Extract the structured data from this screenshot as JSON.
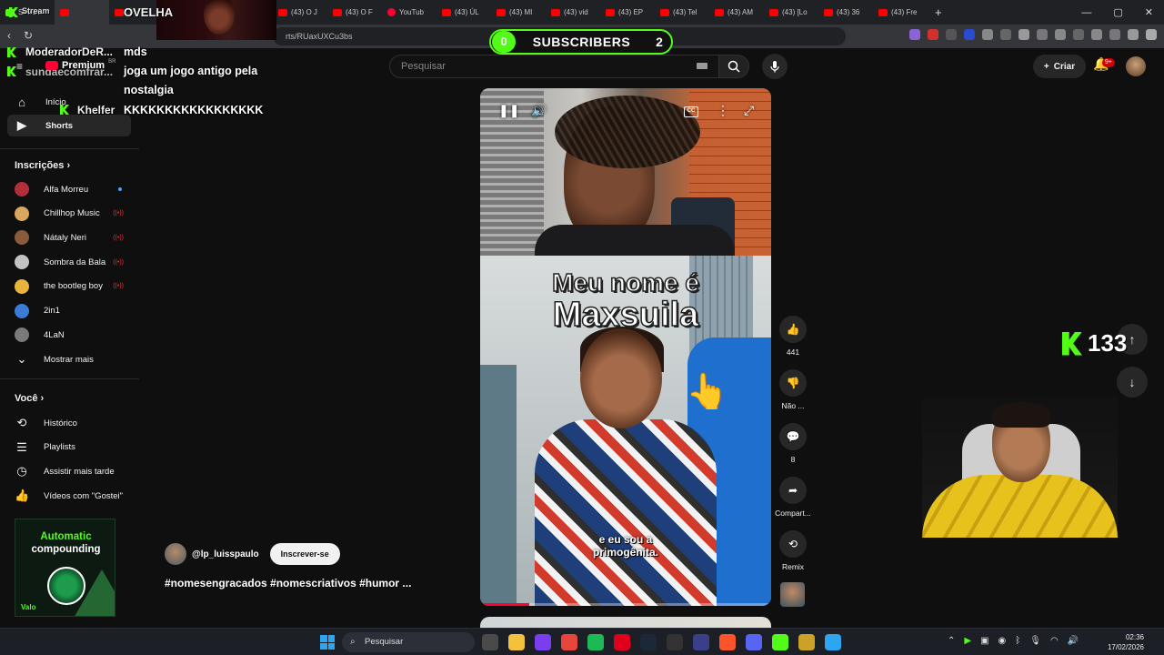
{
  "browser": {
    "tabs": [
      {
        "label": "Stream",
        "icon": "kick"
      },
      {
        "label": "",
        "icon": "youtube",
        "active": true
      },
      {
        "label": "",
        "icon": "youtube"
      },
      {
        "label": "(43) Ser",
        "icon": "youtube"
      },
      {
        "label": "Página",
        "icon": "x"
      },
      {
        "label": "(43) O J",
        "icon": "youtube"
      },
      {
        "label": "(43) O F",
        "icon": "youtube"
      },
      {
        "label": "YouTub",
        "icon": "youtube-music"
      },
      {
        "label": "(43) ÚL",
        "icon": "youtube"
      },
      {
        "label": "(43) MI",
        "icon": "youtube"
      },
      {
        "label": "(43) vid",
        "icon": "youtube"
      },
      {
        "label": "(43) EP",
        "icon": "youtube"
      },
      {
        "label": "(43) Tel",
        "icon": "youtube"
      },
      {
        "label": "(43) AM",
        "icon": "youtube"
      },
      {
        "label": "(43) [Lo",
        "icon": "youtube"
      },
      {
        "label": "(43) 36",
        "icon": "youtube"
      },
      {
        "label": "(43) Fre",
        "icon": "youtube"
      }
    ],
    "new_tab": "+",
    "url": "rts/RUaxUXCu3bs",
    "window_controls": [
      "—",
      "▢",
      "✕"
    ]
  },
  "youtube": {
    "logo_label": "Premium",
    "logo_region": "BR",
    "search_placeholder": "Pesquisar",
    "create_label": "Criar",
    "notif_badge": "9+"
  },
  "sidebar": {
    "main": [
      {
        "label": "Início",
        "icon": "home-icon"
      },
      {
        "label": "Shorts",
        "icon": "shorts-icon",
        "active": true
      }
    ],
    "subs_title": "Inscrições",
    "subs": [
      {
        "name": "Alfa Morreu",
        "color": "#b22f3a",
        "status": "dot"
      },
      {
        "name": "Chillhop Music",
        "color": "#d9a85e",
        "status": "live"
      },
      {
        "name": "Nátaly Neri",
        "color": "#8a5a3c",
        "status": "live"
      },
      {
        "name": "Sombra da Bala",
        "color": "#c3c3c3",
        "status": "live"
      },
      {
        "name": "the bootleg boy",
        "color": "#e8b53c",
        "status": "live"
      },
      {
        "name": "2in1",
        "color": "#3a7bd5",
        "status": ""
      },
      {
        "name": "4LaN",
        "color": "#7a7a7a",
        "status": ""
      }
    ],
    "show_more": "Mostrar mais",
    "you_title": "Você",
    "you": [
      {
        "label": "Histórico",
        "icon": "history-icon"
      },
      {
        "label": "Playlists",
        "icon": "playlist-icon"
      },
      {
        "label": "Assistir mais tarde",
        "icon": "watch-later-icon"
      },
      {
        "label": "Vídeos com \"Gostei\"",
        "icon": "like-icon"
      }
    ]
  },
  "overlay": {
    "chat": [
      {
        "user": "OVELHA",
        "user_color": "#ffffff"
      },
      {
        "user": "ModeradorDeR...",
        "user_color": "#3ea6ff",
        "message": "mds"
      },
      {
        "user": "sundaecomfrar...",
        "user_color": "#e06666",
        "message": "joga um jogo antigo pela"
      },
      {
        "user": "",
        "message": "nostalgia"
      },
      {
        "user": "Khelfer",
        "user_color": "#53fc18",
        "message": "KKKKKKKKKKKKKKKKK"
      }
    ],
    "subscribers": {
      "current": "0",
      "label": "SUBSCRIBERS",
      "total": "2"
    },
    "kick_count": "133",
    "ad": {
      "line1": "Automatic",
      "line2": "compounding",
      "footer": "Valo"
    }
  },
  "short": {
    "caption_line1": "Meu nome é",
    "caption_line2": "Maxsuila",
    "subtitle_line1": "e eu sou a",
    "subtitle_line2": "primogênita.",
    "progress": 0.17,
    "channel": "@lp_luisspaulo",
    "subscribe_label": "Inscrever-se",
    "hashtags": "#nomesengracados #nomescriativos #humor ...",
    "actions": {
      "likes": "441",
      "dislike": "Não ...",
      "comments": "8",
      "share": "Compart...",
      "remix": "Remix"
    }
  },
  "taskbar": {
    "search_placeholder": "Pesquisar",
    "time": "02:36",
    "date": "17/02/2026",
    "apps": [
      "#4a4a4a",
      "#f3c13a",
      "#7a3ef0",
      "#e8453c",
      "#1db954",
      "#e0001b",
      "#1b2838",
      "#333333",
      "#3b3f8a",
      "#fb542b",
      "#5865f2",
      "#53fc18",
      "#c9a227",
      "#2ea5f0"
    ]
  }
}
